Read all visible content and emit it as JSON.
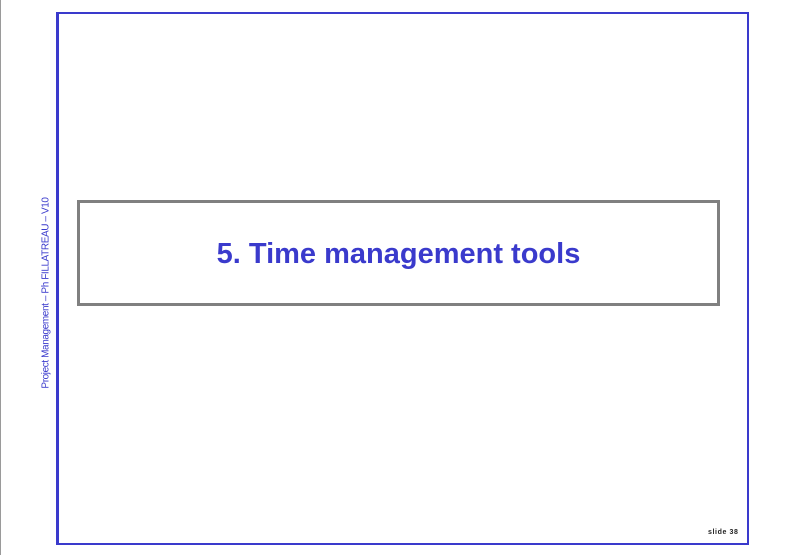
{
  "slide": {
    "side_caption": "Project Management – Ph FILLATREAU – V10",
    "title": "5. Time management tools",
    "slide_number": "slide 38"
  },
  "colors": {
    "accent": "#3a3acc",
    "title_border": "#808080",
    "background": "#ffffff"
  }
}
